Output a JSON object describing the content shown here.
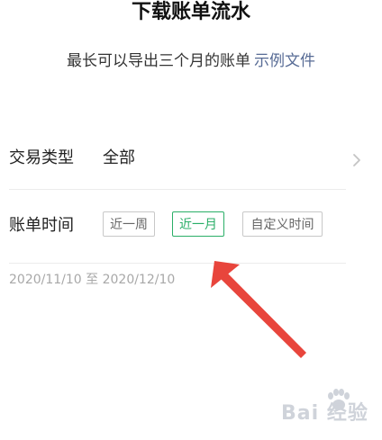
{
  "header": {
    "title": "下载账单流水",
    "subtitle": "最长可以导出三个月的账单",
    "sample_link": "示例文件"
  },
  "transaction_type": {
    "label": "交易类型",
    "value": "全部",
    "chevron_icon": "chevron-right-icon"
  },
  "bill_time": {
    "label": "账单时间",
    "options": [
      {
        "label": "近一周",
        "selected": false
      },
      {
        "label": "近一月",
        "selected": true
      },
      {
        "label": "自定义时间",
        "selected": false
      }
    ]
  },
  "date_range": "2020/11/10 至 2020/12/10",
  "colors": {
    "accent_green": "#2aae67",
    "link_blue": "#576b95",
    "annotation_red": "#e8453c"
  },
  "watermark": {
    "text": "Bai 经验",
    "paw_icon": "baidu-paw-icon"
  }
}
